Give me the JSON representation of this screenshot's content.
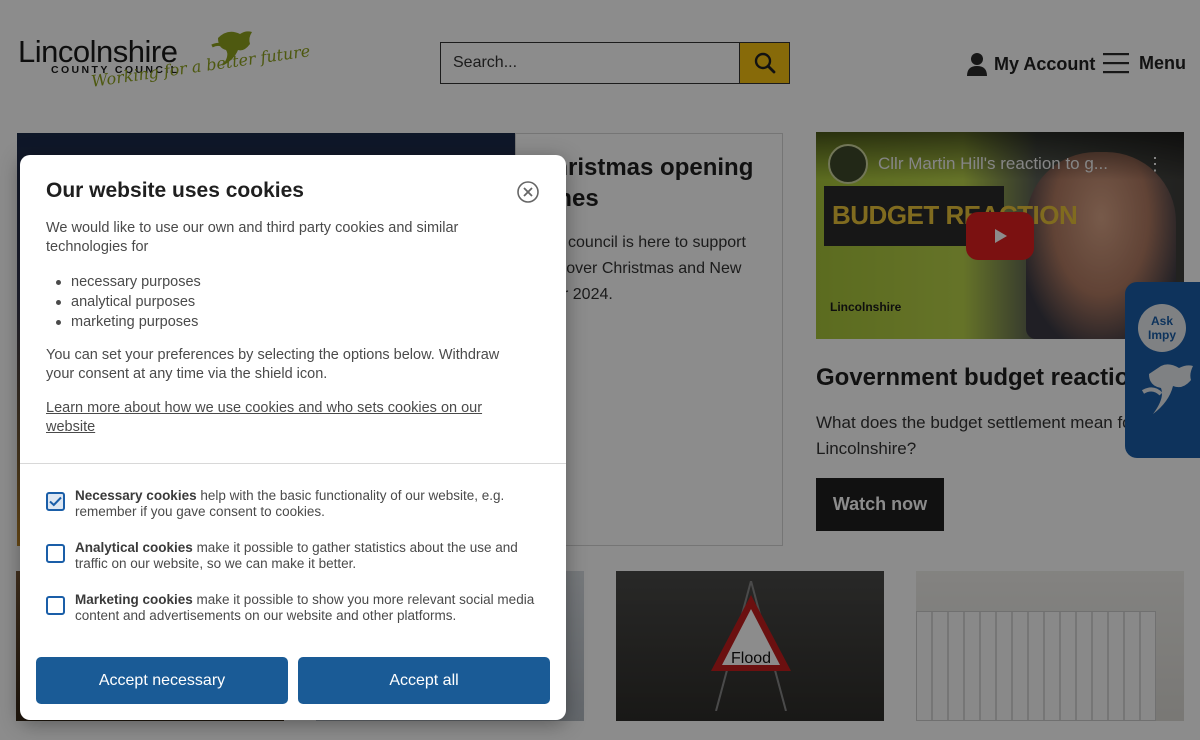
{
  "header": {
    "logo_main": "Lincolnshire",
    "logo_sub": "COUNTY COUNCIL",
    "logo_tagline": "Working for a better future",
    "search_placeholder": "Search...",
    "account_label": "My Account",
    "menu_label": "Menu"
  },
  "hero": {
    "title": "Christmas opening times",
    "text": "The council is here to support you over Christmas and New Year 2024."
  },
  "video": {
    "title": "Cllr Martin Hill's reaction to g...",
    "banner": "BUDGET REACTION",
    "logo": "Lincolnshire"
  },
  "side": {
    "title": "Government budget reaction",
    "text": "What does the budget settlement mean for Lincolnshire?",
    "button": "Watch now"
  },
  "tiles": {
    "flood_sign": "Flood"
  },
  "ask_impy": {
    "line1": "Ask",
    "line2": "Impy"
  },
  "cookie_modal": {
    "title": "Our website uses cookies",
    "intro": "We would like to use our own and third party cookies and similar technologies for",
    "purposes": [
      "necessary purposes",
      "analytical purposes",
      "marketing purposes"
    ],
    "preferences": "You can set your preferences by selecting the options below. Withdraw your consent at any time via the shield icon.",
    "learn_more": "Learn more about how we use cookies and who sets cookies on our website",
    "options": [
      {
        "name": "Necessary cookies",
        "desc": " help with the basic functionality of our website, e.g. remember if you gave consent to cookies.",
        "checked": true
      },
      {
        "name": "Analytical cookies",
        "desc": " make it possible to gather statistics about the use and traffic on our website, so we can make it better.",
        "checked": false
      },
      {
        "name": "Marketing cookies",
        "desc": " make it possible to show you more relevant social media content and advertisements on our website and other platforms.",
        "checked": false
      }
    ],
    "btn_necessary": "Accept necessary",
    "btn_all": "Accept all"
  },
  "colors": {
    "brand_green": "#8ea21e",
    "search_yellow": "#f6c211",
    "button_blue": "#1a5b96",
    "impy_blue": "#1a5ea8"
  }
}
